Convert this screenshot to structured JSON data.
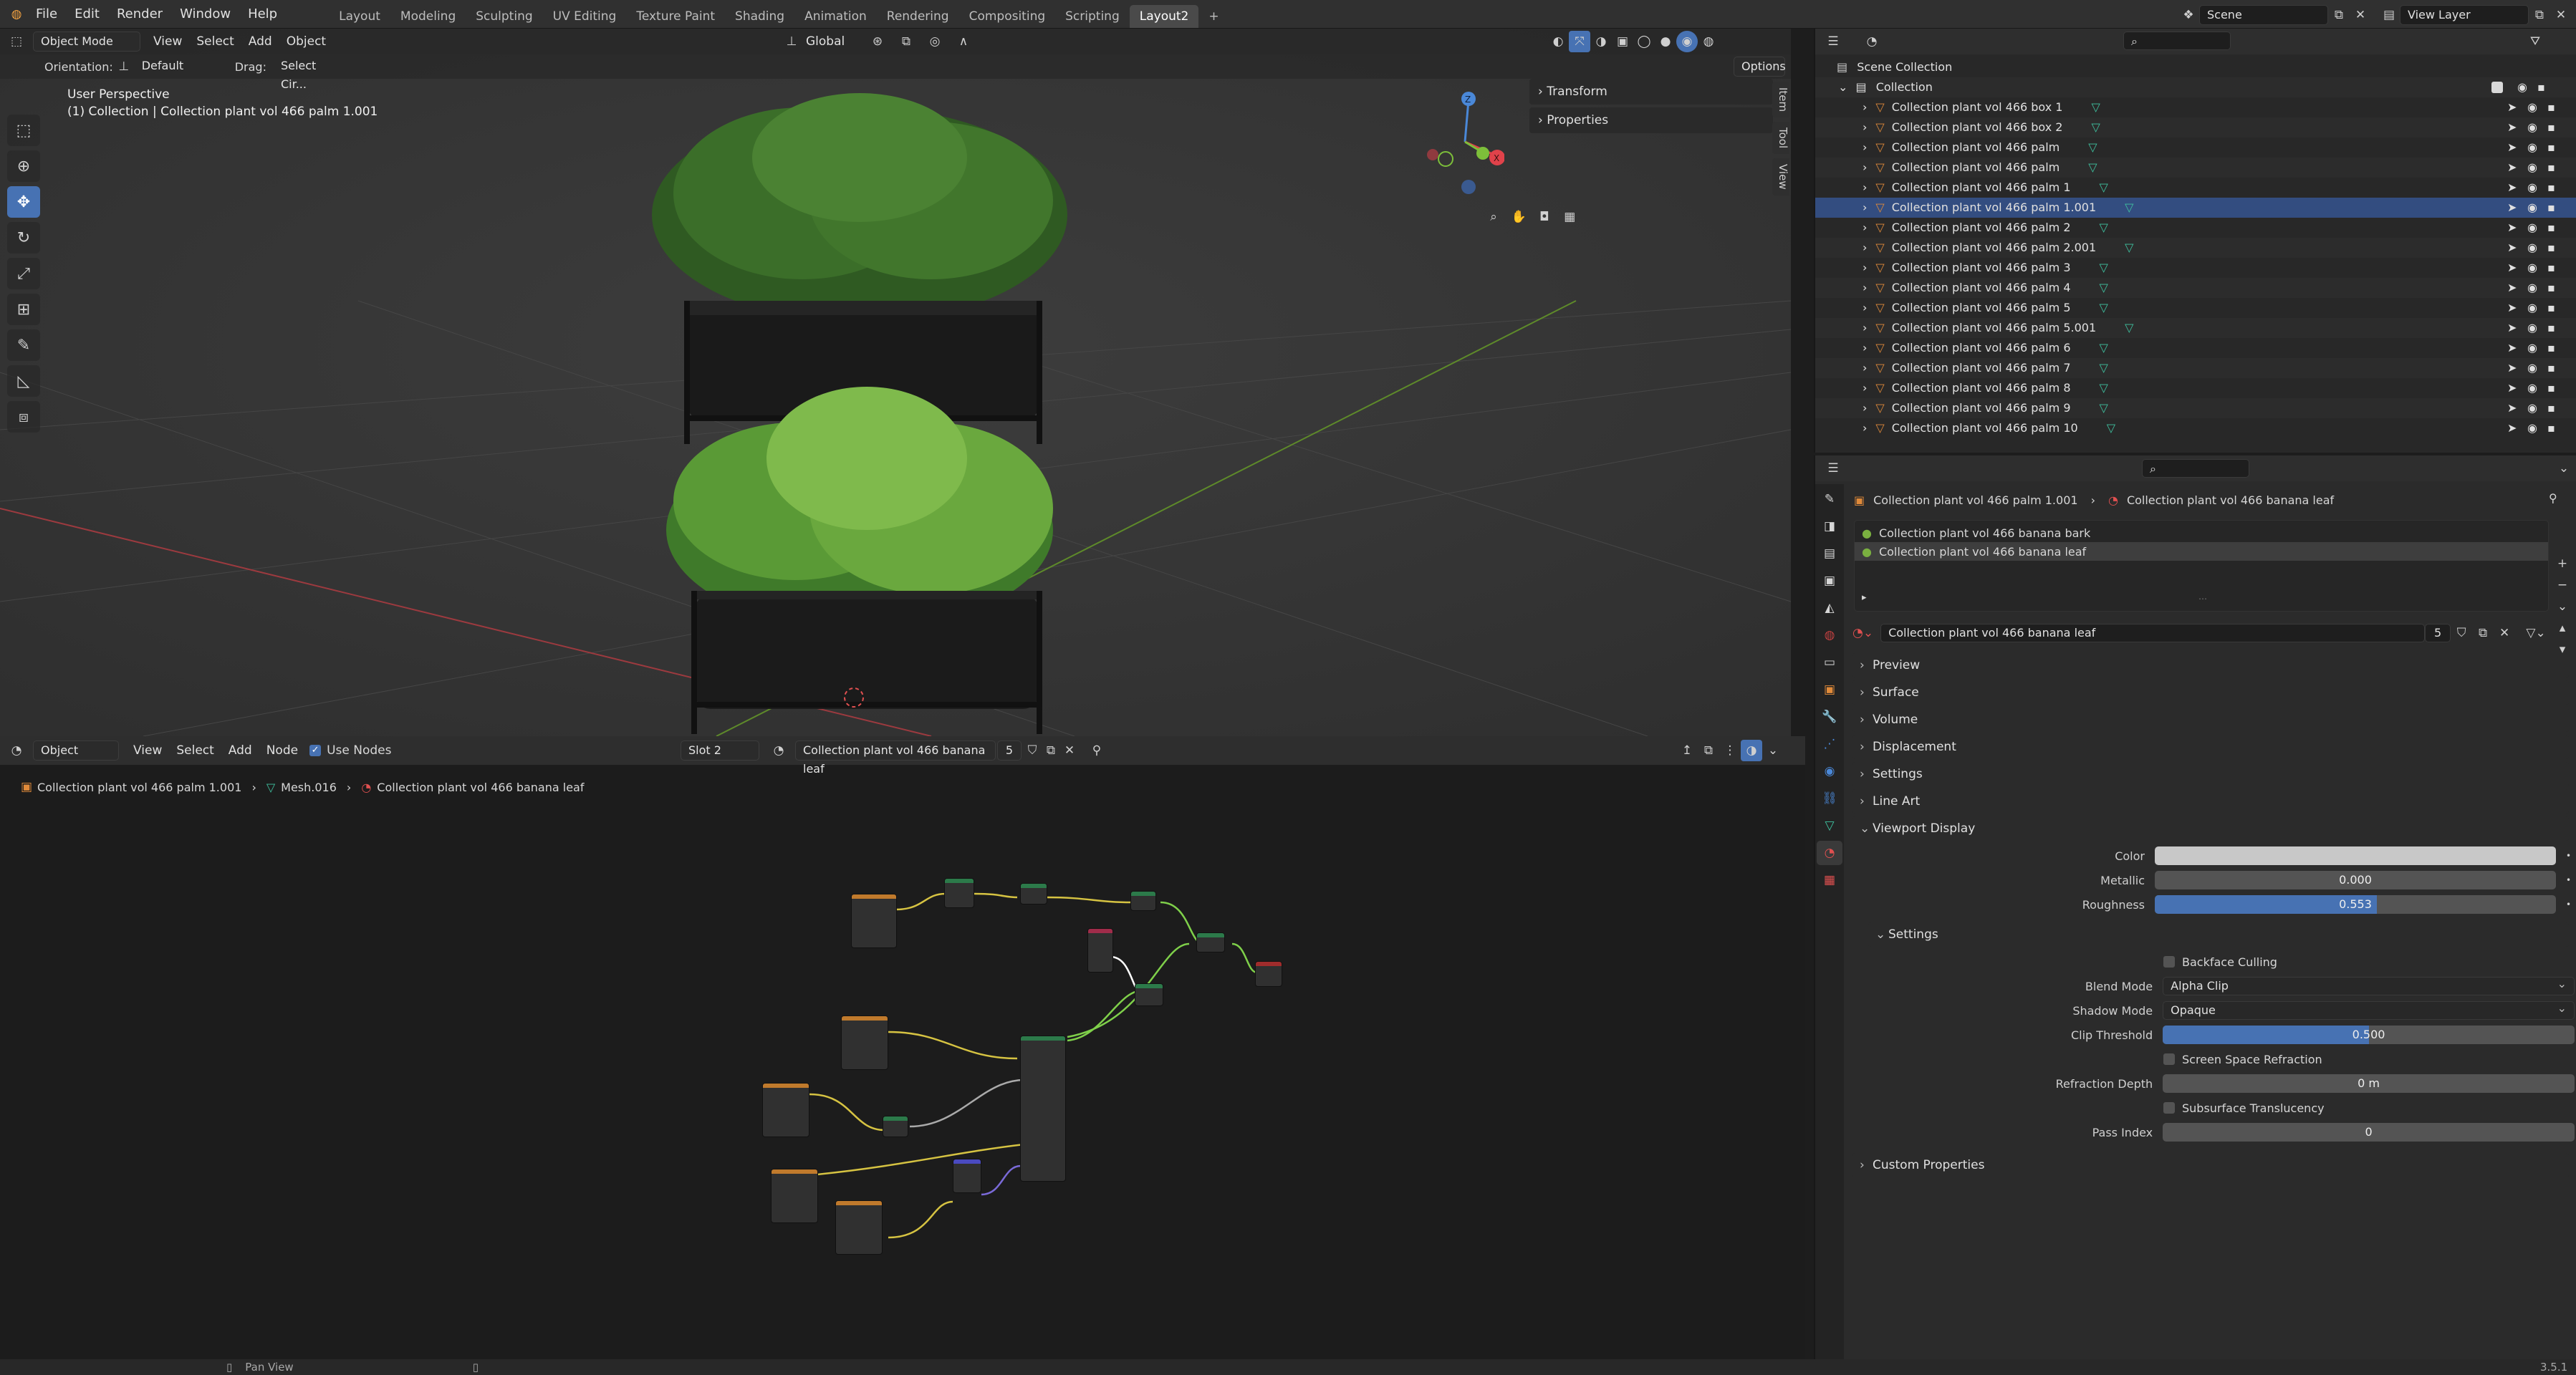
{
  "menubar": {
    "items": [
      "File",
      "Edit",
      "Render",
      "Window",
      "Help"
    ],
    "workspaces": [
      "Layout",
      "Modeling",
      "Sculpting",
      "UV Editing",
      "Texture Paint",
      "Shading",
      "Animation",
      "Rendering",
      "Compositing",
      "Scripting",
      "Layout2"
    ],
    "add_tab": "+",
    "scene": "Scene",
    "view_layer": "View Layer"
  },
  "viewport": {
    "mode": "Object Mode",
    "menus": [
      "View",
      "Select",
      "Add",
      "Object"
    ],
    "transform_orientation": "Global",
    "orientation_label": "Orientation:",
    "orientation_value": "Default",
    "drag_label": "Drag:",
    "drag_value": "Select Cir...",
    "options": "Options",
    "view_name": "User Perspective",
    "view_context": "(1) Collection | Collection plant vol 466 palm 1.001",
    "sidebar": {
      "panels": [
        "Transform",
        "Properties"
      ],
      "tabs": [
        "Item",
        "Tool",
        "View"
      ]
    },
    "gizmo": {
      "z": "Z",
      "x": "X",
      "y": "Y"
    },
    "tools": [
      "select-box",
      "cursor",
      "move",
      "rotate",
      "scale",
      "transform",
      "annotate",
      "measure",
      "add-cube"
    ]
  },
  "node_editor": {
    "type": "Object",
    "menus": [
      "View",
      "Select",
      "Add",
      "Node"
    ],
    "use_nodes": "Use Nodes",
    "slot": "Slot 2",
    "material": "Collection plant vol 466 banana leaf",
    "users": "5",
    "breadcrumb": [
      "Collection plant vol 466 palm 1.001",
      "Mesh.016",
      "Collection plant vol 466 banana leaf"
    ]
  },
  "statusbar": {
    "hint": "Pan View",
    "version": "3.5.1"
  },
  "outliner": {
    "title": "Scene Collection",
    "collection": "Collection",
    "items": [
      "Collection plant vol 466 box 1",
      "Collection plant vol 466 box 2",
      "Collection plant vol 466 palm",
      "Collection plant vol 466 palm",
      "Collection plant vol 466 palm 1",
      "Collection plant vol 466 palm 1.001",
      "Collection plant vol 466 palm 2",
      "Collection plant vol 466 palm 2.001",
      "Collection plant vol 466 palm 3",
      "Collection plant vol 466 palm 4",
      "Collection plant vol 466 palm 5",
      "Collection plant vol 466 palm 5.001",
      "Collection plant vol 466 palm 6",
      "Collection plant vol 466 palm 7",
      "Collection plant vol 466 palm 8",
      "Collection plant vol 466 palm 9",
      "Collection plant vol 466 palm 10"
    ],
    "selected_index": 5
  },
  "properties": {
    "breadcrumb_object": "Collection plant vol 466 palm 1.001",
    "breadcrumb_material": "Collection plant vol 466 banana leaf",
    "slots": [
      "Collection plant vol 466 banana bark",
      "Collection plant vol 466 banana leaf"
    ],
    "active_slot": 1,
    "material_name": "Collection plant vol 466 banana leaf",
    "material_users": "5",
    "panels_closed": [
      "Preview",
      "Surface",
      "Volume",
      "Displacement",
      "Settings",
      "Line Art"
    ],
    "viewport_display": {
      "title": "Viewport Display",
      "color_label": "Color",
      "color": "#c8c8c8",
      "metallic_label": "Metallic",
      "metallic": "0.000",
      "metallic_value": 0.0,
      "roughness_label": "Roughness",
      "roughness": "0.553",
      "roughness_value": 0.553,
      "settings_title": "Settings",
      "backface_culling": "Backface Culling",
      "blend_mode_label": "Blend Mode",
      "blend_mode": "Alpha Clip",
      "shadow_mode_label": "Shadow Mode",
      "shadow_mode": "Opaque",
      "clip_threshold_label": "Clip Threshold",
      "clip_threshold": "0.500",
      "clip_threshold_value": 0.5,
      "ssr": "Screen Space Refraction",
      "refraction_depth_label": "Refraction Depth",
      "refraction_depth": "0 m",
      "subsurface": "Subsurface Translucency",
      "pass_index_label": "Pass Index",
      "pass_index": "0"
    },
    "custom_properties": "Custom Properties"
  },
  "colors": {
    "accent": "#4772b3",
    "x_axis": "#e0424a",
    "y_axis": "#7dbf3a",
    "z_axis": "#4a88d8",
    "mesh": "#3fc2a0",
    "object": "#e08a3a"
  }
}
